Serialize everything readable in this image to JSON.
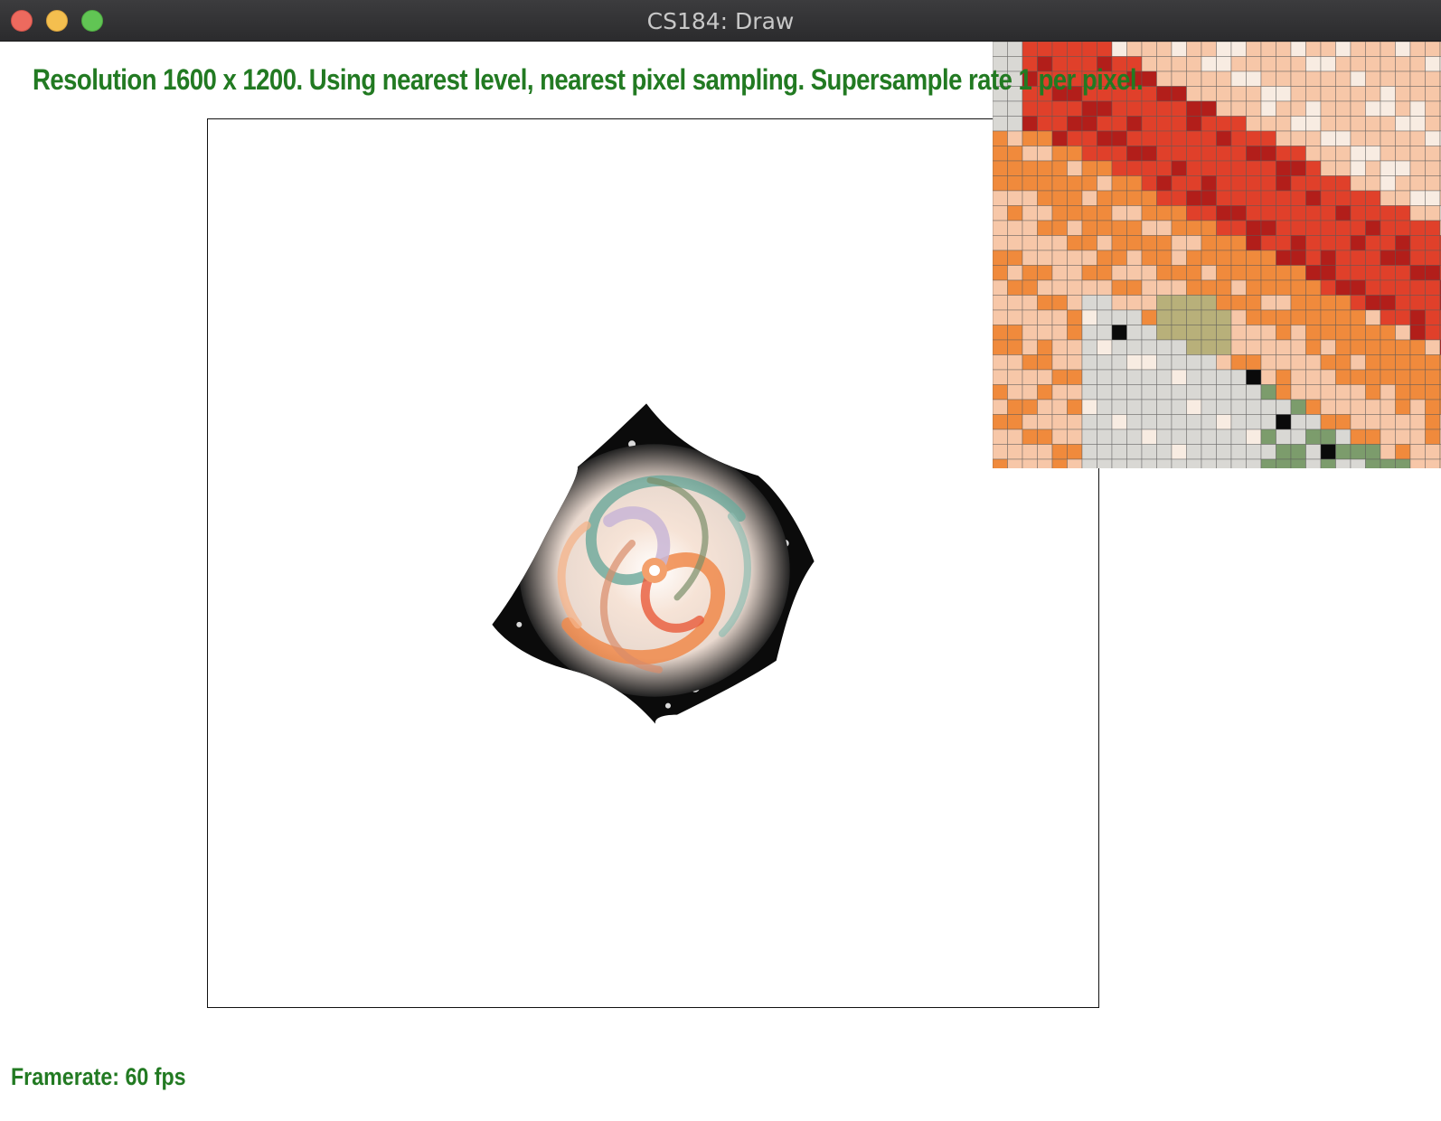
{
  "window": {
    "title": "CS184: Draw",
    "controls": {
      "close_color": "#ed6a5e",
      "minimize_color": "#f4bf4f",
      "maximize_color": "#61c554"
    }
  },
  "status": {
    "info": "Resolution 1600 x 1200. Using nearest level, nearest pixel sampling. Supersample rate 1 per pixel.",
    "framerate": "Framerate: 60 fps",
    "text_color": "#227a22"
  },
  "canvas": {
    "content": "swirled-texture-image",
    "palette": [
      "#000000",
      "#f08a4b",
      "#e85a3a",
      "#c9b6d6",
      "#6aa79a",
      "#f6e3d6",
      "#7a8f6a",
      "#ffffff"
    ]
  },
  "zoom_inset": {
    "content": "magnified-pixel-grid",
    "palette": {
      "red": "#e0402a",
      "dark_red": "#b21e1a",
      "orange": "#f08a3c",
      "peach": "#f7c7a8",
      "cream": "#f8ece2",
      "light_gray": "#d9d8d4",
      "olive": "#b8b07a",
      "green": "#7c9c6c",
      "black": "#0a0a0a"
    }
  }
}
